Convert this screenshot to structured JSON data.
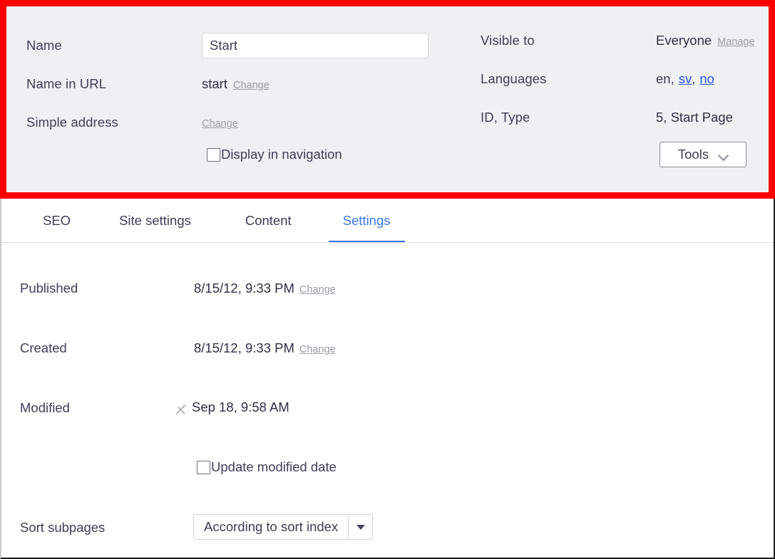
{
  "header_panel": {
    "highlight_color": "#ff0000",
    "background_color": "#eff0f2",
    "left_column": {
      "name": {
        "label": "Name",
        "value": "Start",
        "placeholder": ""
      },
      "name_in_url": {
        "label": "Name in URL",
        "value": "start",
        "change_link": "Change"
      },
      "simple_address": {
        "label": "Simple address",
        "value": "",
        "change_link": "Change"
      },
      "display_in_navigation": {
        "label": "Display in navigation",
        "checked": false
      }
    },
    "right_column": {
      "visible_to": {
        "label": "Visible to",
        "value": "Everyone",
        "manage_link": "Manage"
      },
      "languages": {
        "label": "Languages",
        "current": "en",
        "links": [
          "sv",
          "no"
        ],
        "separator": ","
      },
      "id_type": {
        "label": "ID, Type",
        "value": "5, Start Page"
      },
      "tools_button": {
        "label": "Tools",
        "icon": "chevron-down-icon"
      }
    }
  },
  "tabs": {
    "items": [
      {
        "label": "SEO",
        "active": false
      },
      {
        "label": "Site settings",
        "active": false
      },
      {
        "label": "Content",
        "active": false
      },
      {
        "label": "Settings",
        "active": true
      }
    ],
    "active_color": "#3b78e7"
  },
  "settings": {
    "published": {
      "label": "Published",
      "value": "8/15/12, 9:33 PM",
      "change_link": "Change"
    },
    "created": {
      "label": "Created",
      "value": "8/15/12, 9:33 PM",
      "change_link": "Change"
    },
    "modified": {
      "label": "Modified",
      "icon": "pen-edit-icon",
      "value": "Sep 18, 9:58 AM"
    },
    "update_modified_date": {
      "label": "Update modified date",
      "checked": false
    },
    "sort_subpages": {
      "label": "Sort subpages",
      "value": "According to sort index",
      "icon": "triangle-down-icon"
    }
  }
}
